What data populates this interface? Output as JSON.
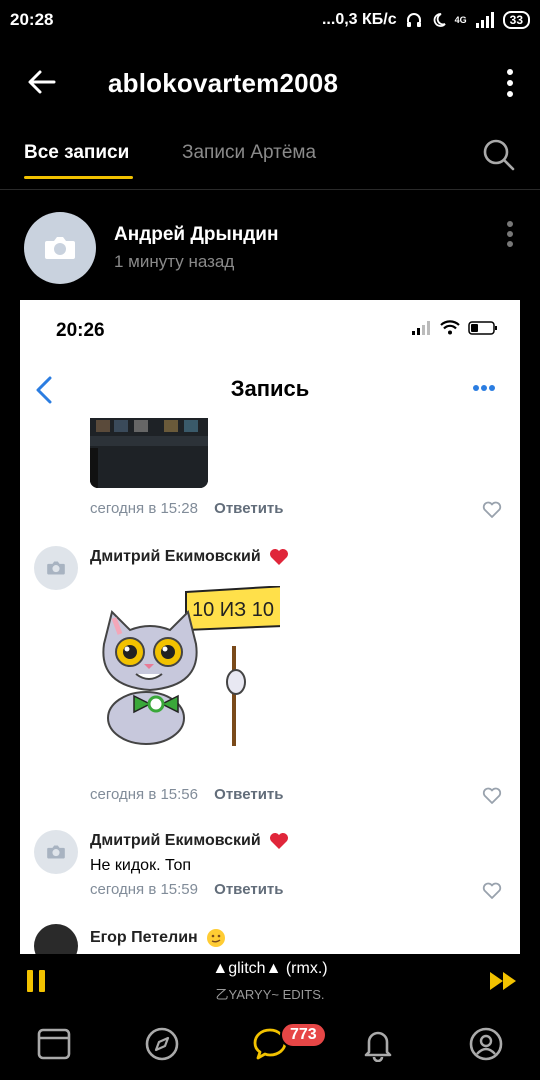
{
  "status_bar": {
    "time": "20:28",
    "network": "...0,3 КБ/с",
    "signal": "4G",
    "battery": "33"
  },
  "header": {
    "title": "ablokovartem2008"
  },
  "tabs": [
    {
      "label": "Все записи",
      "active": true
    },
    {
      "label": "Записи Артёма",
      "active": false
    }
  ],
  "post": {
    "author": "Андрей Дрындин",
    "time": "1 минуту назад"
  },
  "screenshot": {
    "ios_time": "20:26",
    "nav_title": "Запись",
    "comments": [
      {
        "time": "сегодня в 15:28",
        "reply": "Ответить"
      },
      {
        "name": "Дмитрий Екимовский",
        "sticker_text": "10 ИЗ 10",
        "time": "сегодня в 15:56",
        "reply": "Ответить"
      },
      {
        "name": "Дмитрий Екимовский",
        "text": "Не кидок. Топ",
        "time": "сегодня в 15:59",
        "reply": "Ответить"
      },
      {
        "name": "Егор Петелин"
      }
    ]
  },
  "player": {
    "track": "▲glitch▲ (rmx.)",
    "artist": "乙YARYY~ EDITS."
  },
  "tabbar": {
    "badge": "773"
  },
  "colors": {
    "accent": "#f2c200",
    "badge": "#e64646",
    "link": "#2b7de1"
  }
}
